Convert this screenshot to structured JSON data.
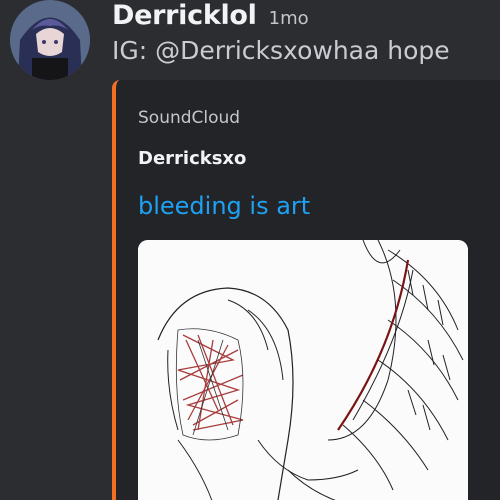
{
  "message": {
    "username": "Derricklol",
    "timestamp": "1mo",
    "content": "IG: @Derricksxowhaa hope",
    "avatar": "avatar-anime-character"
  },
  "embed": {
    "provider": "SoundCloud",
    "author": "Derricksxo",
    "title": "bleeding is art",
    "accent_color": "#f26f23",
    "title_color": "#1ea1f2",
    "image": "sketch-artwork"
  }
}
